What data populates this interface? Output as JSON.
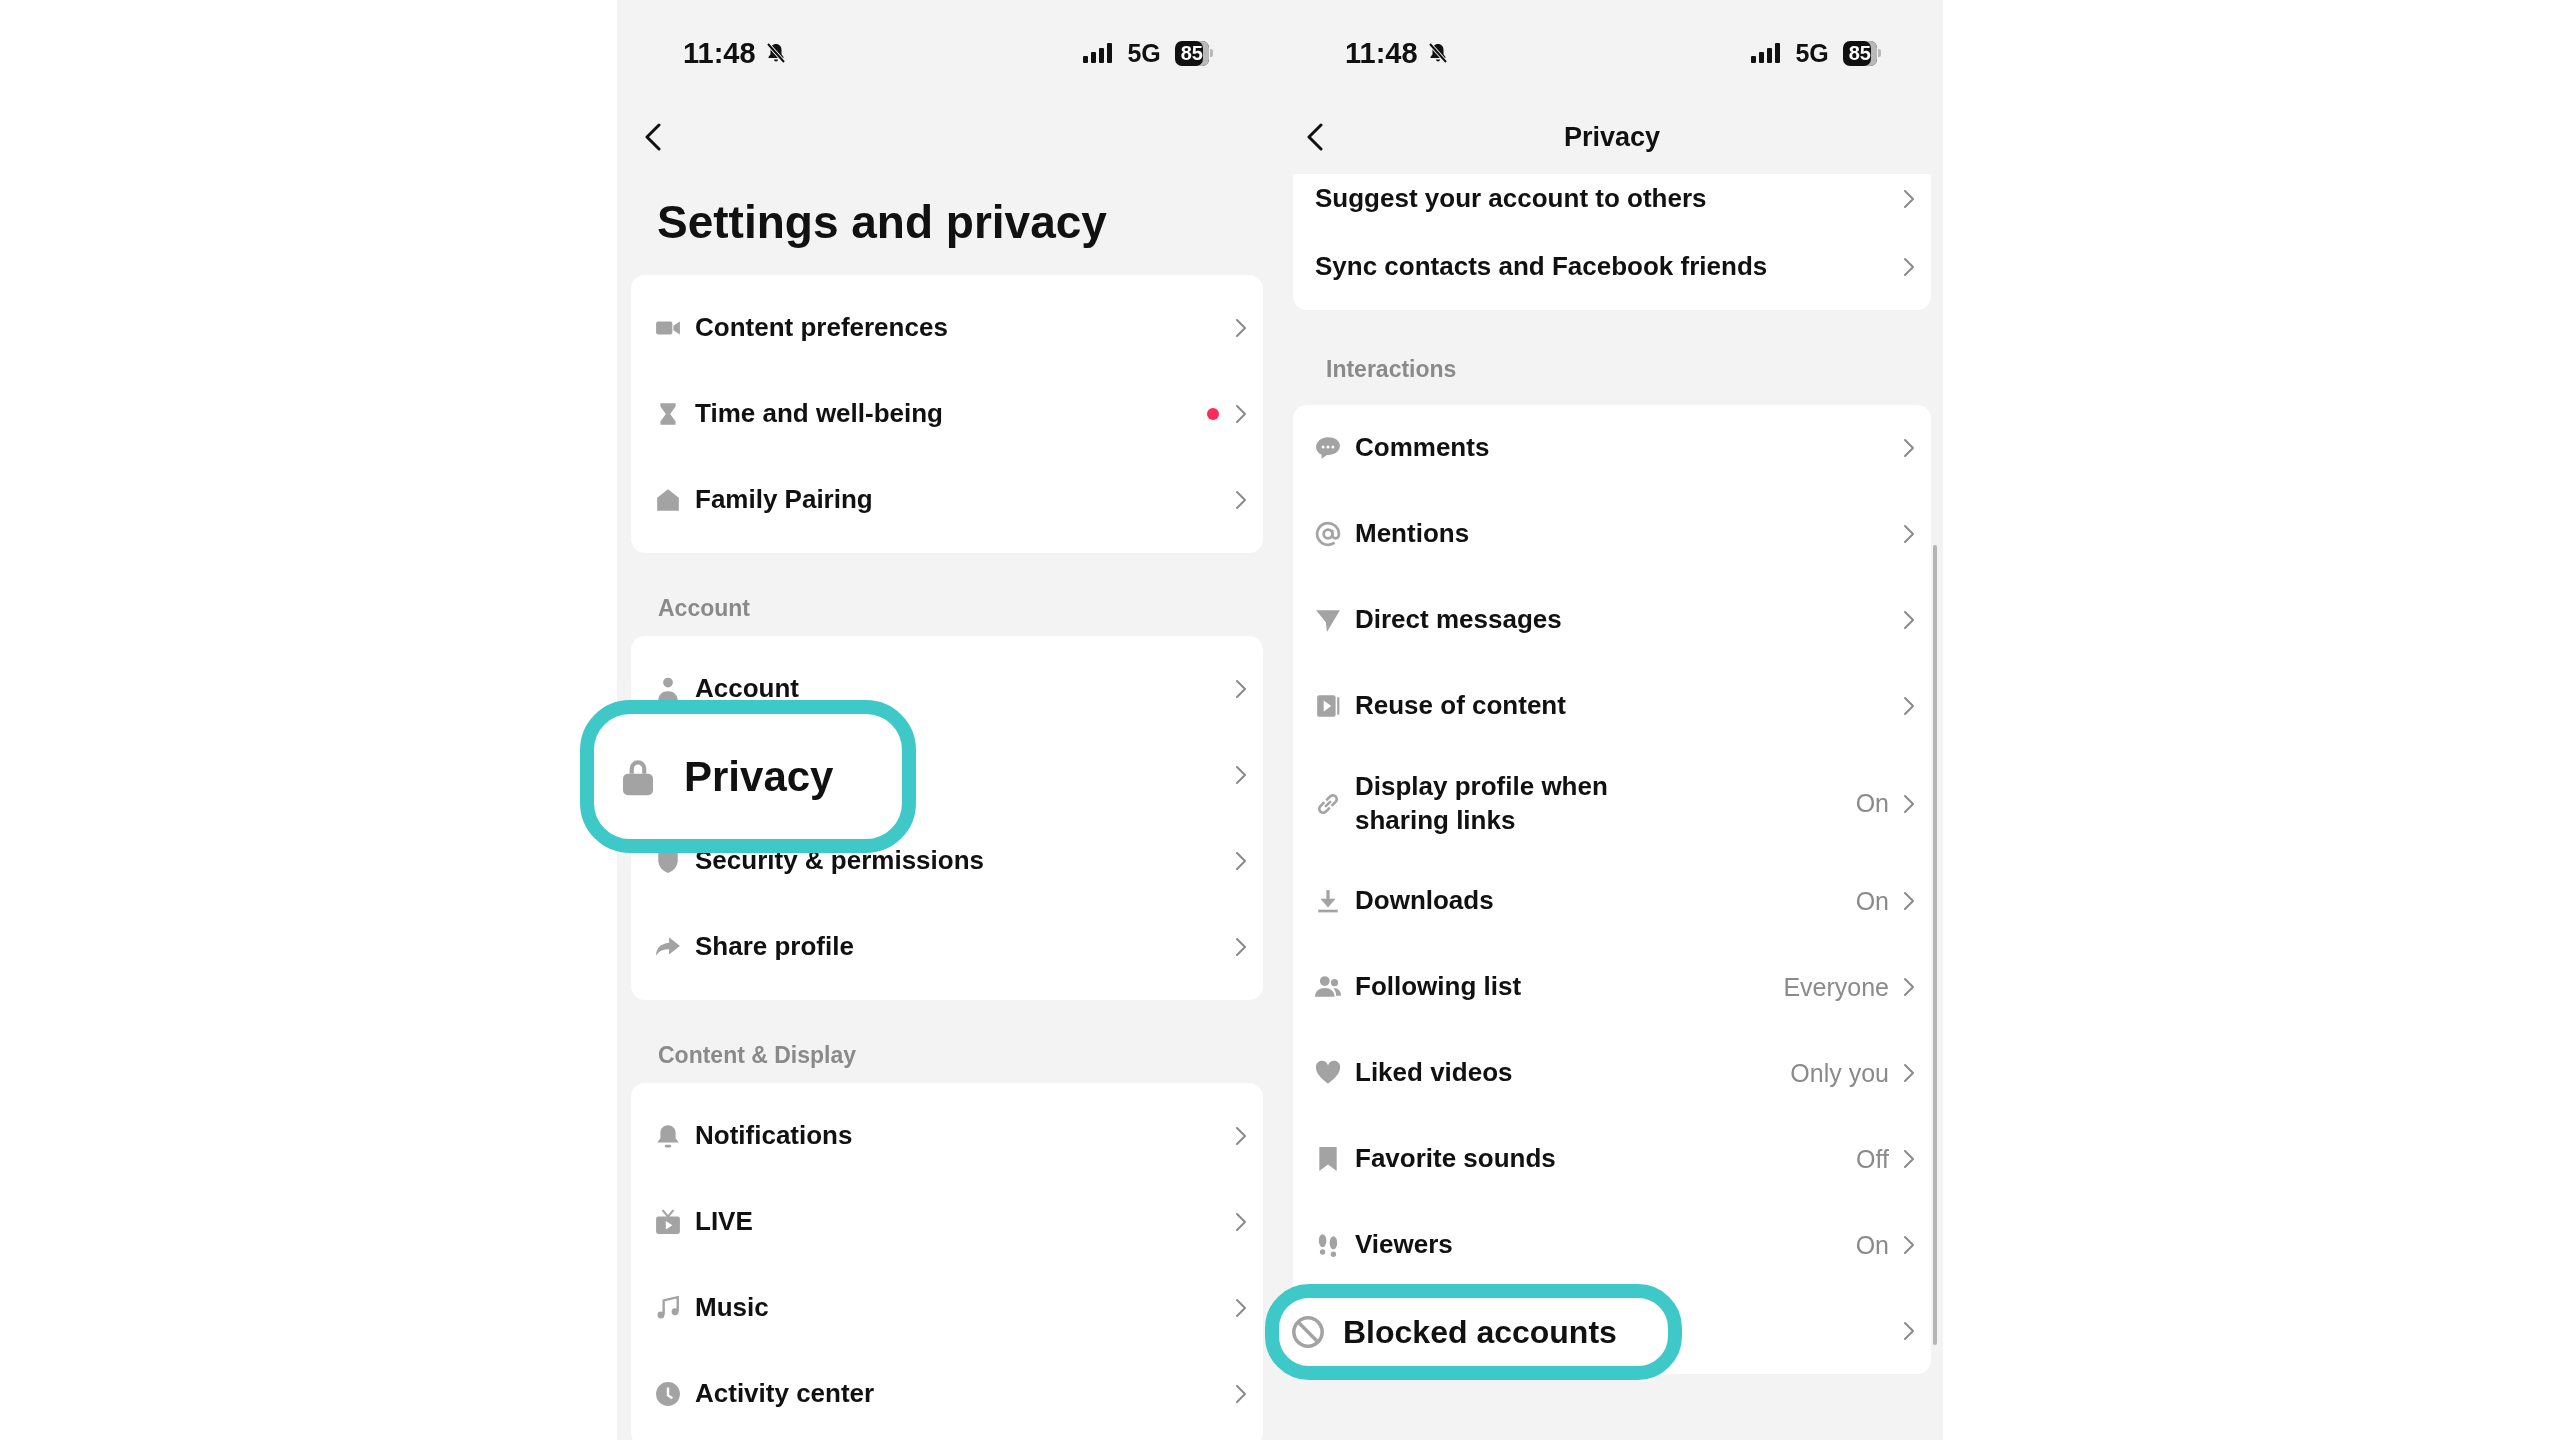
{
  "phones": [
    {
      "status_bar": {
        "time": "11:48",
        "network": "5G",
        "battery": "85"
      },
      "header": {
        "kind": "large",
        "title": "Settings and privacy"
      },
      "sections": [
        {
          "items": [
            {
              "label": "Content preferences",
              "dot": false,
              "highlighted": false
            },
            {
              "label": "Time and well-being",
              "dot": true,
              "highlighted": false
            },
            {
              "label": "Family Pairing",
              "dot": false,
              "highlighted": false
            }
          ]
        },
        {
          "heading": "Account",
          "items": [
            {
              "label": "Account",
              "dot": false,
              "highlighted": false
            },
            {
              "label": "Privacy",
              "dot": false,
              "highlighted": true
            },
            {
              "label": "Security & permissions",
              "dot": false,
              "highlighted": false
            },
            {
              "label": "Share profile",
              "dot": false,
              "highlighted": false
            }
          ]
        },
        {
          "heading": "Content & Display",
          "items": [
            {
              "label": "Notifications",
              "dot": false,
              "highlighted": false
            },
            {
              "label": "LIVE",
              "dot": false,
              "highlighted": false
            },
            {
              "label": "Music",
              "dot": false,
              "highlighted": false
            },
            {
              "label": "Activity center",
              "dot": false,
              "highlighted": false
            }
          ]
        }
      ]
    },
    {
      "status_bar": {
        "time": "11:48",
        "network": "5G",
        "battery": "85"
      },
      "header": {
        "kind": "nav",
        "title": "Privacy"
      },
      "sections": [
        {
          "items": [
            {
              "label": "Suggest your account to others",
              "highlighted": false
            },
            {
              "label": "Sync contacts and Facebook friends",
              "highlighted": false
            }
          ]
        },
        {
          "heading": "Interactions",
          "items": [
            {
              "label": "Comments",
              "highlighted": false
            },
            {
              "label": "Mentions",
              "highlighted": false
            },
            {
              "label": "Direct messages",
              "highlighted": false
            },
            {
              "label": "Reuse of content",
              "highlighted": false
            },
            {
              "label": "Display profile when sharing links",
              "value": "On",
              "highlighted": false
            },
            {
              "label": "Downloads",
              "value": "On",
              "highlighted": false
            },
            {
              "label": "Following list",
              "value": "Everyone",
              "highlighted": false
            },
            {
              "label": "Liked videos",
              "value": "Only you",
              "highlighted": false
            },
            {
              "label": "Favorite sounds",
              "value": "Off",
              "highlighted": false
            },
            {
              "label": "Viewers",
              "value": "On",
              "highlighted": false
            },
            {
              "label": "Blocked accounts",
              "highlighted": true
            }
          ]
        }
      ]
    }
  ]
}
